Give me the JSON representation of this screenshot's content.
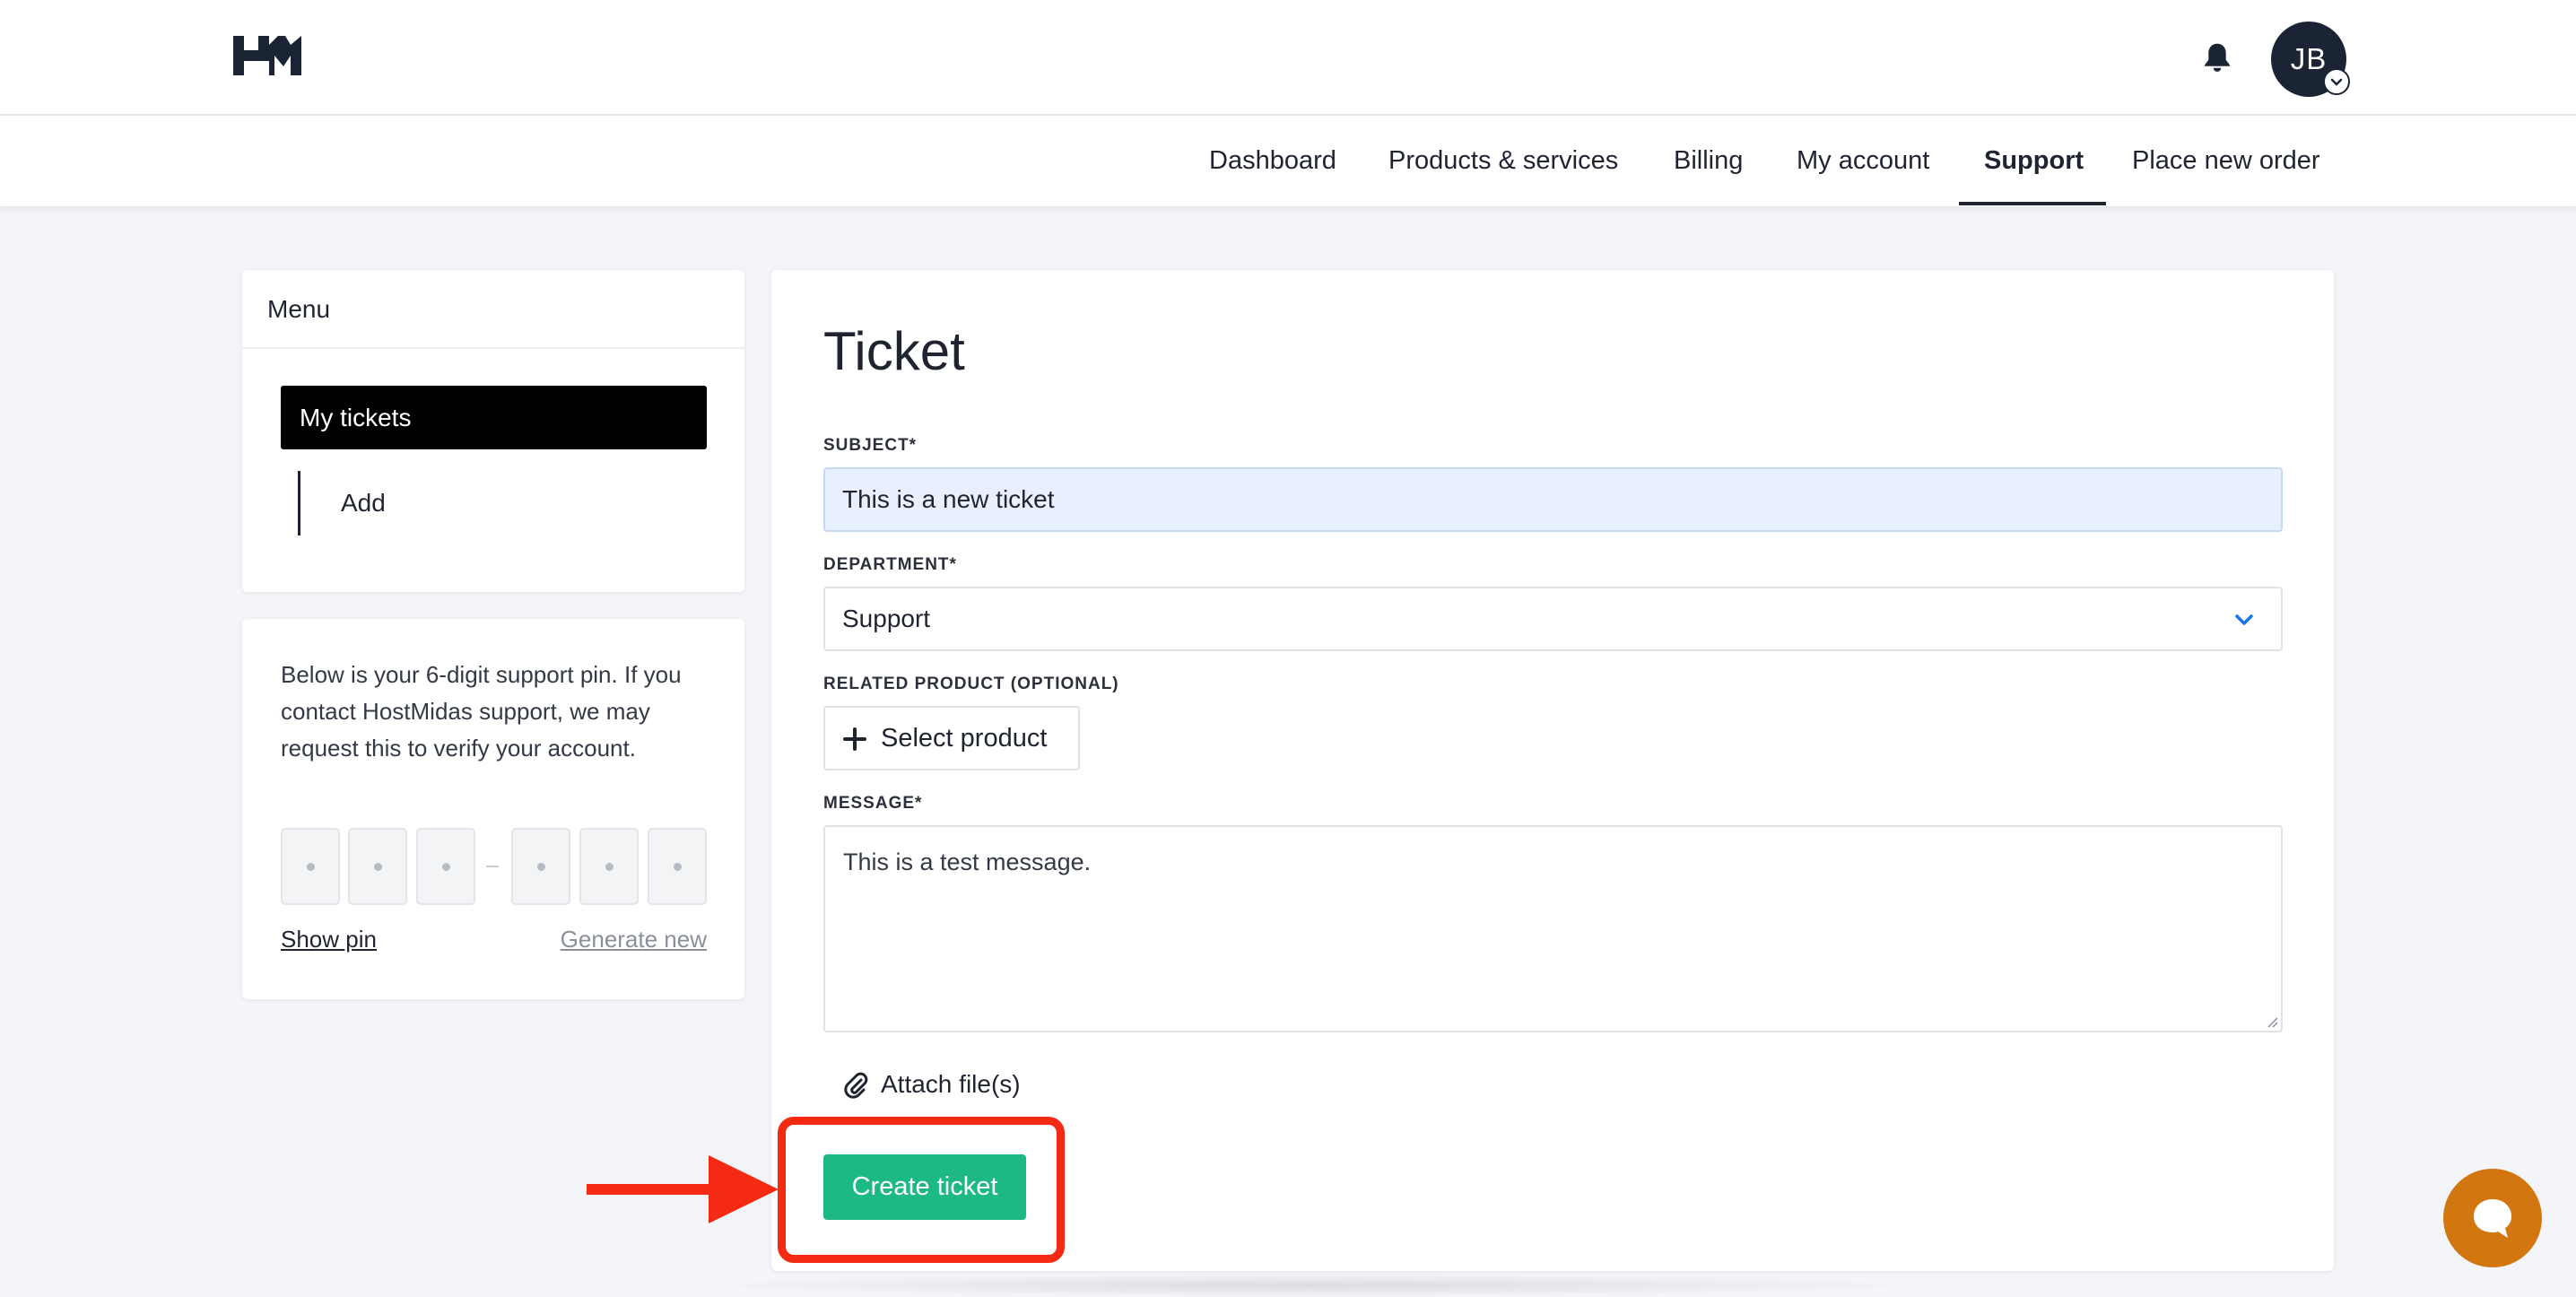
{
  "header": {
    "logo_icon": "hostmidas-logo-icon",
    "notification_icon": "bell-icon",
    "avatar_initials": "JB",
    "avatar_chevron_icon": "chevron-down-icon"
  },
  "nav": {
    "items": [
      {
        "label": "Dashboard"
      },
      {
        "label": "Products & services"
      },
      {
        "label": "Billing"
      },
      {
        "label": "My account"
      },
      {
        "label": "Support"
      },
      {
        "label": "Place new order"
      }
    ],
    "active": "Support"
  },
  "sidebar": {
    "title": "Menu",
    "items": [
      {
        "label": "My tickets"
      },
      {
        "label": "Add"
      }
    ],
    "active": "My tickets"
  },
  "pin": {
    "description": "Below is your 6-digit support pin. If you contact HostMidas support, we may request this to verify your account.",
    "show_label": "Show pin",
    "generate_label": "Generate new"
  },
  "ticket": {
    "title": "Ticket",
    "subject_label": "SUBJECT*",
    "subject_value": "This is a new ticket",
    "department_label": "DEPARTMENT*",
    "department_value": "Support",
    "related_label": "RELATED PRODUCT (OPTIONAL)",
    "select_product_label": "Select product",
    "message_label": "MESSAGE*",
    "message_value": "This is a test message.",
    "attach_label": "Attach file(s)",
    "create_label": "Create ticket"
  },
  "colors": {
    "accent_green": "#1cb983",
    "annotation_red": "#f52a12",
    "chat_orange": "#d2770f",
    "dark": "#1b2434"
  }
}
